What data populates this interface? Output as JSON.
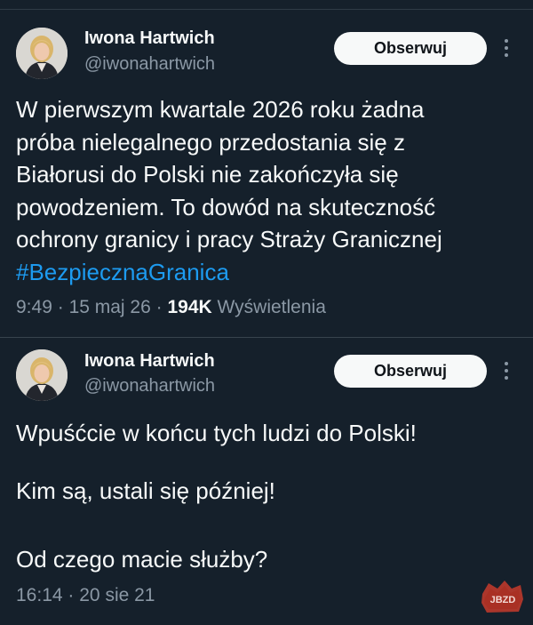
{
  "tweets": [
    {
      "author": {
        "name": "Iwona Hartwich",
        "handle": "@iwonahartwich"
      },
      "follow_label": "Obserwuj",
      "text_lines": [
        "W pierwszym kwartale 2026 roku żadna",
        "próba nielegalnego przedostania się z",
        "Białorusi do Polski nie zakończyła się",
        "powodzeniem. To dowód na skuteczność",
        "ochrony granicy i pracy Straży Granicznej"
      ],
      "hashtag": "#BezpiecznaGranica",
      "time": "9:49",
      "date": "15 maj 26",
      "views_count": "194K",
      "views_label": "Wyświetlenia",
      "separator": "·"
    },
    {
      "author": {
        "name": "Iwona Hartwich",
        "handle": "@iwonahartwich"
      },
      "follow_label": "Obserwuj",
      "paragraphs": [
        "Wpuśćcie w końcu tych ludzi do Polski!",
        "Kim są, ustali się później!",
        "Od czego macie służby?"
      ],
      "time": "16:14",
      "date": "20 sie 21",
      "separator": "·"
    }
  ],
  "watermark": {
    "text": "JBZD"
  },
  "colors": {
    "background": "#15202b",
    "text": "#f7f9f9",
    "secondary": "#8b98a5",
    "link": "#1d9bf0",
    "button_bg": "#f7f9f9",
    "watermark": "#c0392b"
  },
  "icons": {
    "more": "more-vertical-icon",
    "avatar": "profile-photo"
  }
}
